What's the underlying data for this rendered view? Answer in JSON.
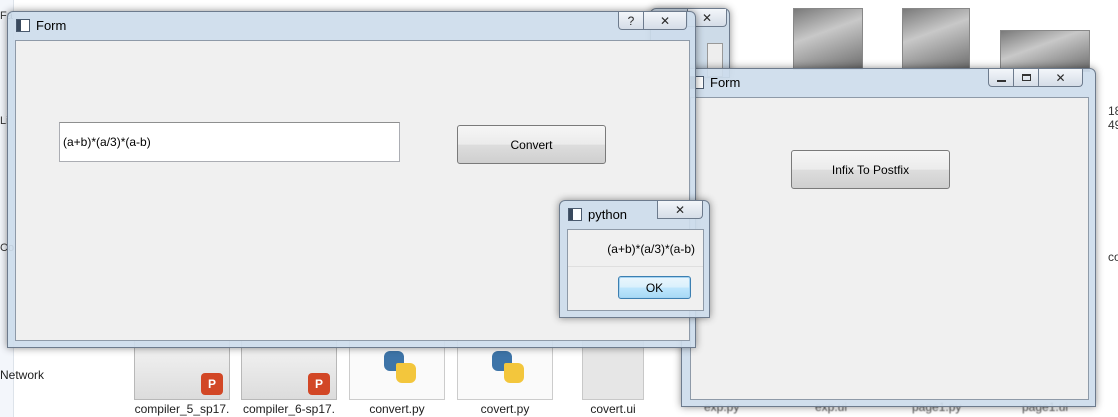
{
  "explorer": {
    "nav_network": "Network",
    "files": [
      {
        "name": "compiler_5_sp17.",
        "kind": "pptx"
      },
      {
        "name": "compiler_6-sp17.",
        "kind": "pptx"
      },
      {
        "name": "convert.py",
        "kind": "python"
      },
      {
        "name": "covert.py",
        "kind": "python"
      },
      {
        "name": "covert.ui",
        "kind": "ui"
      }
    ],
    "hidden_files": [
      "exp.py",
      "exp.ui",
      "page1.py",
      "page1.ui"
    ],
    "right_edge_text": [
      "18",
      "49",
      "co"
    ]
  },
  "form_main": {
    "title": "Form",
    "help_label": "?",
    "close_label": "✕",
    "input_value": "(a+b)*(a/3)*(a-b)",
    "button_label": "Convert"
  },
  "form_second": {
    "title": "Form",
    "close_label": "✕",
    "button_label": "Infix To Postfix"
  },
  "dialog": {
    "title": "python",
    "close_label": "✕",
    "message": "(a+b)*(a/3)*(a-b)",
    "ok_label": "OK"
  },
  "behind_window": {
    "close_label": "✕"
  },
  "colors": {
    "accent": "#3c7fb1",
    "frame": "#c9dbeb",
    "client": "#f0f0f0",
    "ppt_badge": "#d24726"
  }
}
